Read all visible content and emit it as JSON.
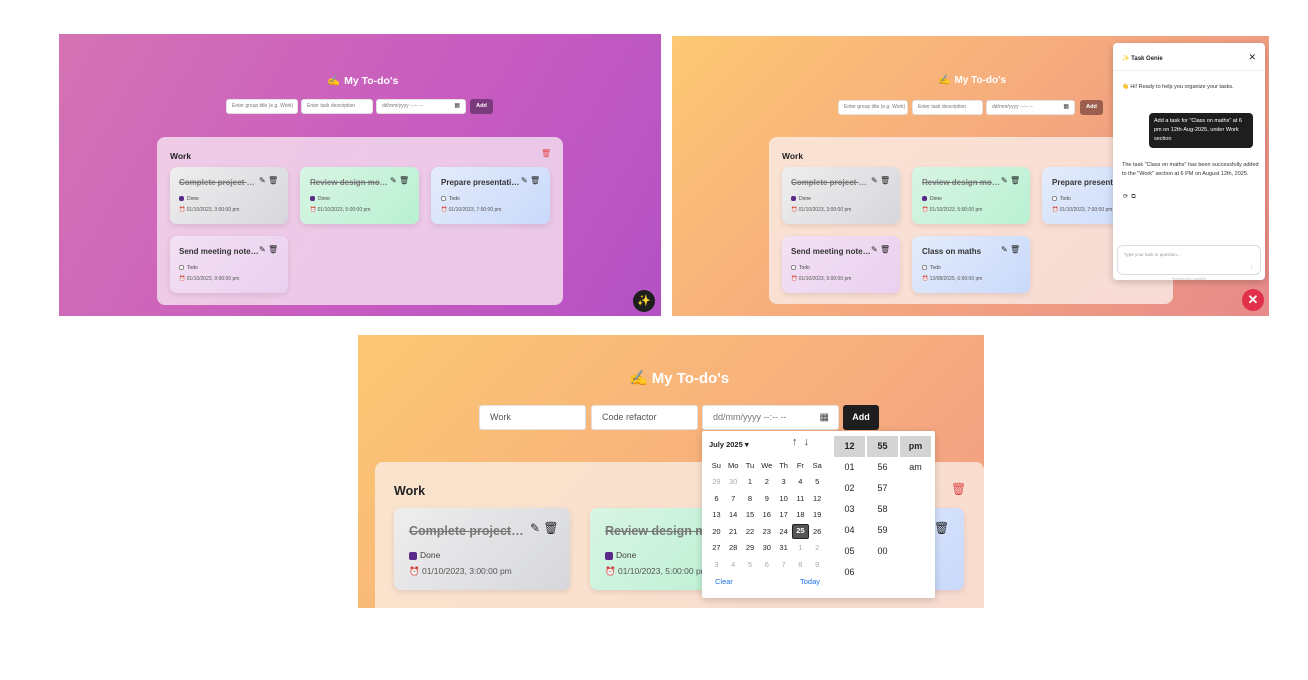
{
  "app": {
    "title": "My To-do's",
    "title_emoji": "✍️"
  },
  "inputs_empty": {
    "group_placeholder": "Enter group title (e.g. Work)",
    "task_placeholder": "Enter task description",
    "date_placeholder": "dd/mm/yyyy --:-- --",
    "add_label": "Add"
  },
  "inputs_filled": {
    "group_value": "Work",
    "task_value": "Code refactor",
    "date_placeholder": "dd/mm/yyyy --:-- --",
    "add_label": "Add"
  },
  "group": {
    "title": "Work"
  },
  "tasks": [
    {
      "title": "Complete project pr...",
      "status": "Done",
      "date": "01/10/2023, 3:00:00 pm",
      "done": true
    },
    {
      "title": "Review design mock...",
      "status": "Done",
      "date": "01/10/2023, 5:00:00 pm",
      "done": true
    },
    {
      "title": "Prepare presentatio...",
      "status": "Todo",
      "date": "01/10/2023, 7:00:00 pm",
      "done": false
    },
    {
      "title": "Send meeting notes ...",
      "status": "Todo",
      "date": "01/10/2023, 9:00:00 pm",
      "done": false
    },
    {
      "title": "Class on maths",
      "status": "Todo",
      "date": "12/08/2025, 6:00:00 pm",
      "done": false
    }
  ],
  "panel_b_titles": {
    "prepare": "Prepare presentat",
    "review": "Review design mock..."
  },
  "panel_c_titles": {
    "review": "Review design moc"
  },
  "chat": {
    "title": "Task Genie",
    "title_emoji": "✨",
    "close": "✕",
    "greeting": "👋 Hi! Ready to help you organize your tasks.",
    "user_message": "Add a task for \"Class on maths\" at 6 pm on 12th-Aug-2025, under Work section",
    "bot_reply": "The task \"Class on maths\" has been successfully added to the \"Work\" section at 6 PM on August 12th, 2025.",
    "input_placeholder": "Type your task or question...",
    "powered": "Powered by CopilotKit"
  },
  "datepicker": {
    "month_label": "July 2025 ▾",
    "weekdays": [
      "Su",
      "Mo",
      "Tu",
      "We",
      "Th",
      "Fr",
      "Sa"
    ],
    "weeks": [
      [
        "29",
        "30",
        "1",
        "2",
        "3",
        "4",
        "5"
      ],
      [
        "6",
        "7",
        "8",
        "9",
        "10",
        "11",
        "12"
      ],
      [
        "13",
        "14",
        "15",
        "16",
        "17",
        "18",
        "19"
      ],
      [
        "20",
        "21",
        "22",
        "23",
        "24",
        "25",
        "26"
      ],
      [
        "27",
        "28",
        "29",
        "30",
        "31",
        "1",
        "2"
      ],
      [
        "3",
        "4",
        "5",
        "6",
        "7",
        "8",
        "9"
      ]
    ],
    "selected_day": "25",
    "clear": "Clear",
    "today": "Today",
    "hours": [
      "12",
      "01",
      "02",
      "03",
      "04",
      "05",
      "06"
    ],
    "minutes": [
      "55",
      "56",
      "57",
      "58",
      "59",
      "00"
    ],
    "ampm": [
      "pm",
      "am"
    ]
  },
  "colors": {
    "accent_dark": "#1e1e1e",
    "purple_add": "#7b3a7e",
    "brown_add": "#9c5e4e",
    "delete_red": "#e04848",
    "link_blue": "#1a73e8"
  }
}
